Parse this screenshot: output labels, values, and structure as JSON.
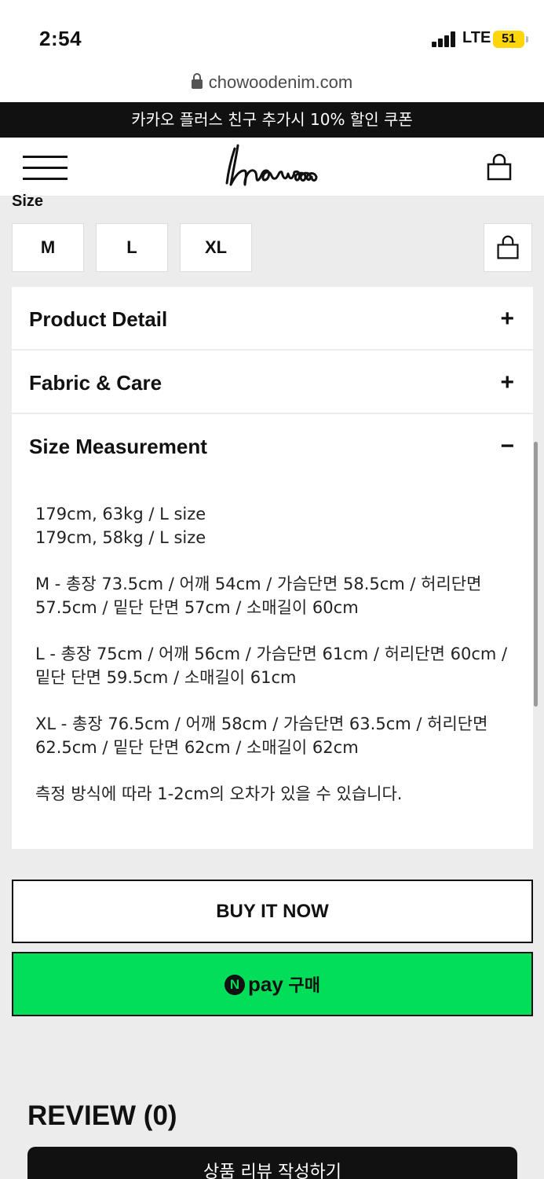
{
  "status_bar": {
    "time": "2:54",
    "network": "LTE",
    "battery": "51"
  },
  "browser": {
    "url": "chowoodenim.com"
  },
  "banner": {
    "text": "카카오 플러스 친구 추가시 10% 할인 쿠폰"
  },
  "header": {
    "logo_icon": "chowoo-script-logo",
    "menu_icon": "hamburger-icon",
    "cart_icon": "shopping-bag-icon"
  },
  "product": {
    "size_label": "Size",
    "sizes": [
      "M",
      "L",
      "XL"
    ]
  },
  "accordions": [
    {
      "title": "Product Detail",
      "sign": "+"
    },
    {
      "title": "Fabric & Care",
      "sign": "+"
    },
    {
      "title": "Size Measurement",
      "sign": "−"
    }
  ],
  "size_measurement": {
    "models": [
      "179cm, 63kg / L size",
      "179cm, 58kg / L size"
    ],
    "m": "M - 총장 73.5cm / 어깨 54cm / 가슴단면 58.5cm / 허리단면 57.5cm / 밑단 단면 57cm / 소매길이 60cm",
    "l": "L - 총장 75cm / 어깨 56cm / 가슴단면 61cm / 허리단면 60cm / 밑단 단면 59.5cm / 소매길이 61cm",
    "xl": "XL - 총장 76.5cm / 어깨 58cm / 가슴단면 63.5cm / 허리단면 62.5cm / 밑단 단면 62cm / 소매길이 62cm",
    "note": "측정 방식에 따라 1-2cm의 오차가 있을 수 있습니다."
  },
  "buttons": {
    "buy_now": "BUY IT NOW",
    "npay_n": "N",
    "npay_word": "pay",
    "npay_kr": "구매"
  },
  "review": {
    "title": "REVIEW (0)",
    "write_button": "상품 리뷰 작성하기"
  },
  "colors": {
    "npay_green": "#03de5a",
    "banner_bg": "#111111",
    "page_bg": "#ececec",
    "battery": "#ffd60a"
  }
}
